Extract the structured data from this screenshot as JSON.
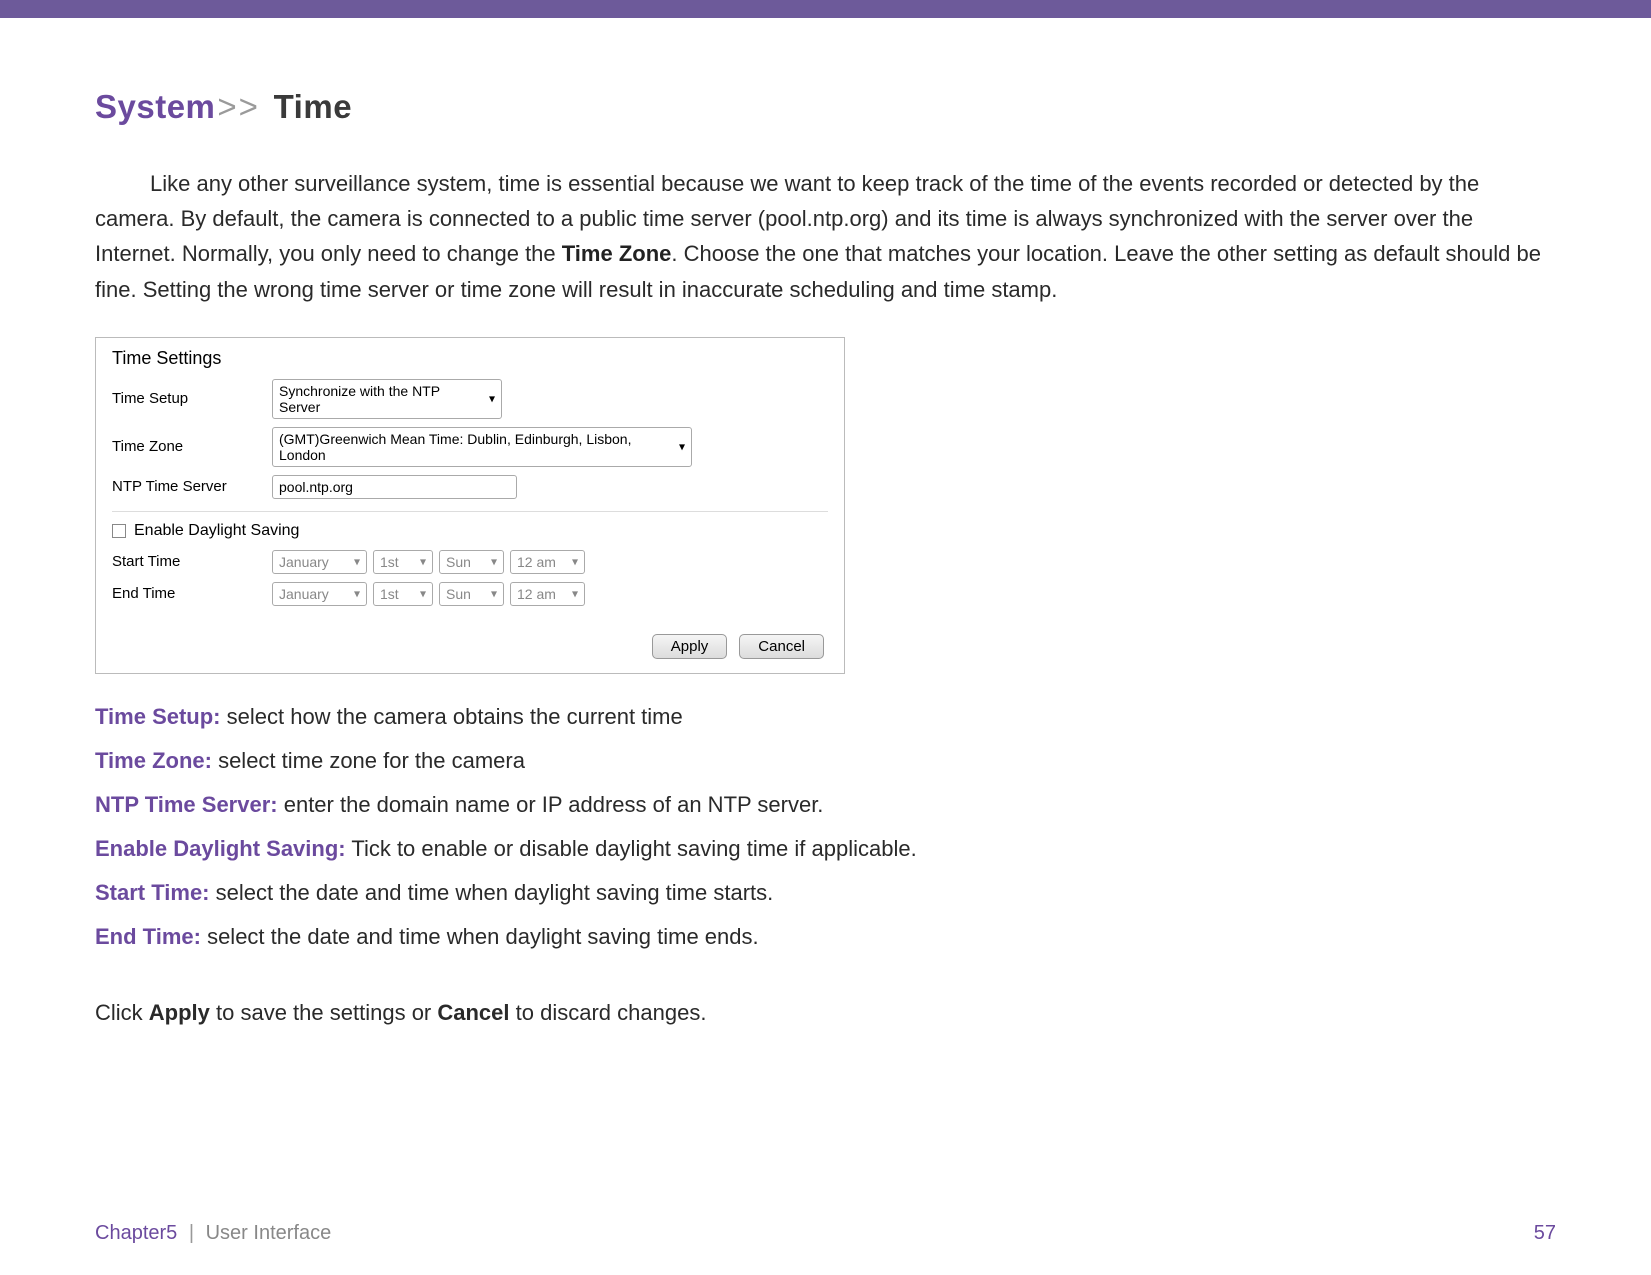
{
  "heading": {
    "section": "System",
    "sep": ">>",
    "page": "Time"
  },
  "intro": {
    "p1a": "Like any other surveillance system, time is essential because we want to keep track of the time of the events recorded or detected by the camera. By default, the camera is connected to a public time server (pool.ntp.org) and its time is always synchronized with the server over the Internet. Normally, you only need to change the ",
    "p1b": "Time Zone",
    "p1c": ". Choose the one that matches your location. Leave the other setting as default should be fine. Setting the wrong time server or time zone will result in inaccurate scheduling and time stamp."
  },
  "panel": {
    "title": "Time Settings",
    "rows": {
      "time_setup": {
        "label": "Time Setup",
        "value": "Synchronize with the NTP Server"
      },
      "time_zone": {
        "label": "Time Zone",
        "value": "(GMT)Greenwich Mean Time: Dublin, Edinburgh, Lisbon, London"
      },
      "ntp": {
        "label": "NTP Time Server",
        "value": "pool.ntp.org"
      }
    },
    "dls": {
      "checked": false,
      "label": "Enable Daylight Saving",
      "start": {
        "label": "Start Time",
        "month": "January",
        "day": "1st",
        "dow": "Sun",
        "hour": "12 am"
      },
      "end": {
        "label": "End Time",
        "month": "January",
        "day": "1st",
        "dow": "Sun",
        "hour": "12 am"
      }
    },
    "buttons": {
      "apply": "Apply",
      "cancel": "Cancel"
    }
  },
  "defs": [
    {
      "term": "Time Setup:",
      "desc": " select how the camera obtains the current time"
    },
    {
      "term": "Time Zone:",
      "desc": " select time zone for the camera"
    },
    {
      "term": "NTP Time Server:",
      "desc": " enter the domain name or IP address of an NTP server."
    },
    {
      "term": "Enable Daylight Saving:",
      "desc": "  Tick to enable or disable daylight saving time if applicable."
    },
    {
      "term": "Start Time:",
      "desc": " select the date and time when daylight saving time starts."
    },
    {
      "term": "End Time:",
      "desc": " select the date and time when daylight saving time ends."
    }
  ],
  "closing": {
    "a": "Click ",
    "b1": "Apply",
    "c": " to save the settings or ",
    "b2": "Cancel",
    "d": " to discard changes."
  },
  "footer": {
    "chapter": "Chapter5",
    "sep": "|",
    "label": "User Interface",
    "page": "57"
  }
}
